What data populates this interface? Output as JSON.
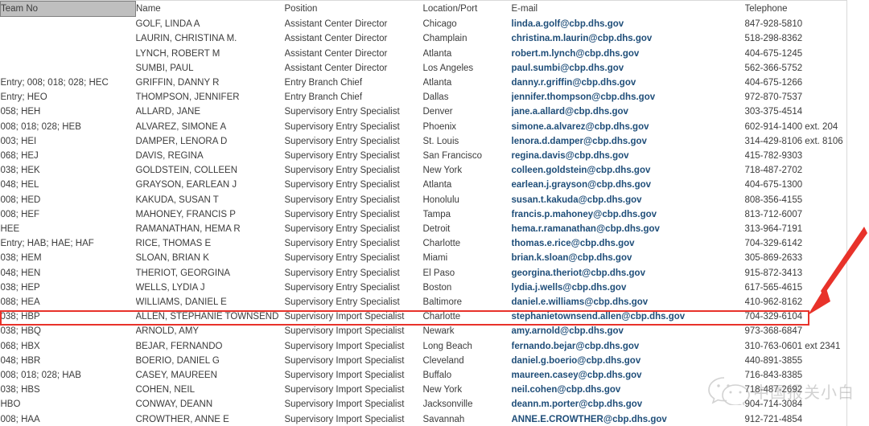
{
  "table": {
    "columns": [
      {
        "key": "team",
        "label": "Team No"
      },
      {
        "key": "name",
        "label": "Name"
      },
      {
        "key": "pos",
        "label": "Position"
      },
      {
        "key": "loc",
        "label": "Location/Port"
      },
      {
        "key": "mail",
        "label": "E-mail"
      },
      {
        "key": "tel",
        "label": "Telephone"
      }
    ],
    "selected_header_cell": "Team No",
    "rows": [
      {
        "team": "",
        "name": "GOLF, LINDA A",
        "pos": "Assistant Center Director",
        "loc": "Chicago",
        "mail": "linda.a.golf@cbp.dhs.gov",
        "tel": "847-928-5810"
      },
      {
        "team": "",
        "name": "LAURIN, CHRISTINA M.",
        "pos": "Assistant Center Director",
        "loc": "Champlain",
        "mail": "christina.m.laurin@cbp.dhs.gov",
        "tel": "518-298-8362"
      },
      {
        "team": "",
        "name": "LYNCH, ROBERT M",
        "pos": "Assistant Center Director",
        "loc": "Atlanta",
        "mail": "robert.m.lynch@cbp.dhs.gov",
        "tel": "404-675-1245"
      },
      {
        "team": "",
        "name": "SUMBI, PAUL",
        "pos": "Assistant Center Director",
        "loc": "Los Angeles",
        "mail": "paul.sumbi@cbp.dhs.gov",
        "tel": "562-366-5752"
      },
      {
        "team": "Entry; 008; 018; 028; HEC",
        "name": "GRIFFIN, DANNY R",
        "pos": "Entry Branch Chief",
        "loc": "Atlanta",
        "mail": "danny.r.griffin@cbp.dhs.gov",
        "tel": "404-675-1266"
      },
      {
        "team": "Entry; HEO",
        "name": "THOMPSON, JENNIFER",
        "pos": "Entry Branch Chief",
        "loc": "Dallas",
        "mail": "jennifer.thompson@cbp.dhs.gov",
        "tel": "972-870-7537"
      },
      {
        "team": "058; HEH",
        "name": "ALLARD, JANE",
        "pos": "Supervisory Entry Specialist",
        "loc": "Denver",
        "mail": "jane.a.allard@cbp.dhs.gov",
        "tel": "303-375-4514"
      },
      {
        "team": "008; 018; 028; HEB",
        "name": "ALVAREZ, SIMONE A",
        "pos": "Supervisory Entry Specialist",
        "loc": "Phoenix",
        "mail": "simone.a.alvarez@cbp.dhs.gov",
        "tel": "602-914-1400 ext. 204"
      },
      {
        "team": "003; HEI",
        "name": "DAMPER, LENORA D",
        "pos": "Supervisory Entry Specialist",
        "loc": "St. Louis",
        "mail": "lenora.d.damper@cbp.dhs.gov",
        "tel": "314-429-8106 ext. 8106"
      },
      {
        "team": "068; HEJ",
        "name": "DAVIS, REGINA",
        "pos": "Supervisory Entry Specialist",
        "loc": "San Francisco",
        "mail": "regina.davis@cbp.dhs.gov",
        "tel": "415-782-9303"
      },
      {
        "team": "038; HEK",
        "name": "GOLDSTEIN, COLLEEN",
        "pos": "Supervisory Entry Specialist",
        "loc": "New York",
        "mail": "colleen.goldstein@cbp.dhs.gov",
        "tel": "718-487-2702"
      },
      {
        "team": "048; HEL",
        "name": "GRAYSON, EARLEAN J",
        "pos": "Supervisory Entry Specialist",
        "loc": "Atlanta",
        "mail": "earlean.j.grayson@cbp.dhs.gov",
        "tel": "404-675-1300"
      },
      {
        "team": "008; HED",
        "name": "KAKUDA, SUSAN T",
        "pos": "Supervisory Entry Specialist",
        "loc": "Honolulu",
        "mail": "susan.t.kakuda@cbp.dhs.gov",
        "tel": "808-356-4155"
      },
      {
        "team": "008; HEF",
        "name": "MAHONEY, FRANCIS P",
        "pos": "Supervisory Entry Specialist",
        "loc": "Tampa",
        "mail": "francis.p.mahoney@cbp.dhs.gov",
        "tel": "813-712-6007"
      },
      {
        "team": "HEE",
        "name": "RAMANATHAN, HEMA R",
        "pos": "Supervisory Entry Specialist",
        "loc": "Detroit",
        "mail": "hema.r.ramanathan@cbp.dhs.gov",
        "tel": "313-964-7191"
      },
      {
        "team": "Entry; HAB; HAE; HAF",
        "name": "RICE, THOMAS E",
        "pos": "Supervisory Entry Specialist",
        "loc": "Charlotte",
        "mail": "thomas.e.rice@cbp.dhs.gov",
        "tel": "704-329-6142"
      },
      {
        "team": "038; HEM",
        "name": "SLOAN, BRIAN K",
        "pos": "Supervisory Entry Specialist",
        "loc": "Miami",
        "mail": "brian.k.sloan@cbp.dhs.gov",
        "tel": "305-869-2633"
      },
      {
        "team": "048; HEN",
        "name": "THERIOT, GEORGINA",
        "pos": "Supervisory Entry Specialist",
        "loc": "El Paso",
        "mail": "georgina.theriot@cbp.dhs.gov",
        "tel": "915-872-3413"
      },
      {
        "team": "038; HEP",
        "name": "WELLS, LYDIA J",
        "pos": "Supervisory Entry Specialist",
        "loc": "Boston",
        "mail": "lydia.j.wells@cbp.dhs.gov",
        "tel": "617-565-4615"
      },
      {
        "team": "088; HEA",
        "name": "WILLIAMS, DANIEL E",
        "pos": "Supervisory Entry Specialist",
        "loc": "Baltimore",
        "mail": "daniel.e.williams@cbp.dhs.gov",
        "tel": "410-962-8162"
      },
      {
        "team": "038; HBP",
        "name": "ALLEN, STEPHANIE TOWNSEND",
        "pos": "Supervisory Import Specialist",
        "loc": "Charlotte",
        "mail": "stephanietownsend.allen@cbp.dhs.gov",
        "tel": "704-329-6104"
      },
      {
        "team": "038; HBQ",
        "name": "ARNOLD, AMY",
        "pos": "Supervisory Import Specialist",
        "loc": "Newark",
        "mail": "amy.arnold@cbp.dhs.gov",
        "tel": "973-368-6847"
      },
      {
        "team": "068; HBX",
        "name": "BEJAR, FERNANDO",
        "pos": "Supervisory Import Specialist",
        "loc": "Long Beach",
        "mail": "fernando.bejar@cbp.dhs.gov",
        "tel": "310-763-0601 ext 2341"
      },
      {
        "team": "048; HBR",
        "name": "BOERIO, DANIEL G",
        "pos": "Supervisory Import Specialist",
        "loc": "Cleveland",
        "mail": "daniel.g.boerio@cbp.dhs.gov",
        "tel": "440-891-3855"
      },
      {
        "team": "008; 018; 028; HAB",
        "name": "CASEY, MAUREEN",
        "pos": "Supervisory Import Specialist",
        "loc": "Buffalo",
        "mail": "maureen.casey@cbp.dhs.gov",
        "tel": "716-843-8385"
      },
      {
        "team": "038; HBS",
        "name": "COHEN, NEIL",
        "pos": "Supervisory Import Specialist",
        "loc": "New York",
        "mail": "neil.cohen@cbp.dhs.gov",
        "tel": "718-487-2692"
      },
      {
        "team": "HBO",
        "name": "CONWAY, DEANN",
        "pos": "Supervisory Import Specialist",
        "loc": "Jacksonville",
        "mail": "deann.m.porter@cbp.dhs.gov",
        "tel": "904-714-3084"
      },
      {
        "team": "008; HAA",
        "name": "CROWTHER, ANNE E",
        "pos": "Supervisory Import Specialist",
        "loc": "Savannah",
        "mail": "ANNE.E.CROWTHER@cbp.dhs.gov",
        "tel": "912-721-4854"
      }
    ]
  },
  "annotations": {
    "highlight_row_index": 20,
    "highlight_color": "#e8322a",
    "arrow_color": "#e8322a"
  },
  "watermark": {
    "text": "中国报关小白",
    "logo": "wechat-logo"
  },
  "colors": {
    "email_link": "#1f4e79",
    "text": "#3b3b3b",
    "header_cell_fill": "#bfbfbf",
    "header_cell_border": "#808080",
    "grid_line": "#d9d9d9"
  }
}
